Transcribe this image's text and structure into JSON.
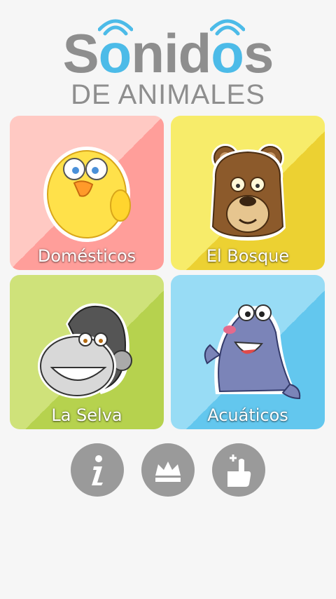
{
  "logo": {
    "title_part1": "S",
    "title_o1": "o",
    "title_part2": "nid",
    "title_o2": "o",
    "title_part3": "s",
    "subtitle": "DE ANIMALES",
    "accent_color": "#4cbbe8"
  },
  "categories": [
    {
      "label": "Domésticos",
      "icon": "chick-icon",
      "color_a": "#ffc9c3",
      "color_b": "#ff9e9a"
    },
    {
      "label": "El Bosque",
      "icon": "bear-icon",
      "color_a": "#f7ec6a",
      "color_b": "#ecd132"
    },
    {
      "label": "La Selva",
      "icon": "gorilla-icon",
      "color_a": "#cfe27a",
      "color_b": "#b6d24e"
    },
    {
      "label": "Acuáticos",
      "icon": "seal-icon",
      "color_a": "#98dcf5",
      "color_b": "#63c7ee"
    }
  ],
  "actions": [
    {
      "icon": "info-icon"
    },
    {
      "icon": "crown-icon"
    },
    {
      "icon": "thumbs-up-plus-icon"
    }
  ]
}
